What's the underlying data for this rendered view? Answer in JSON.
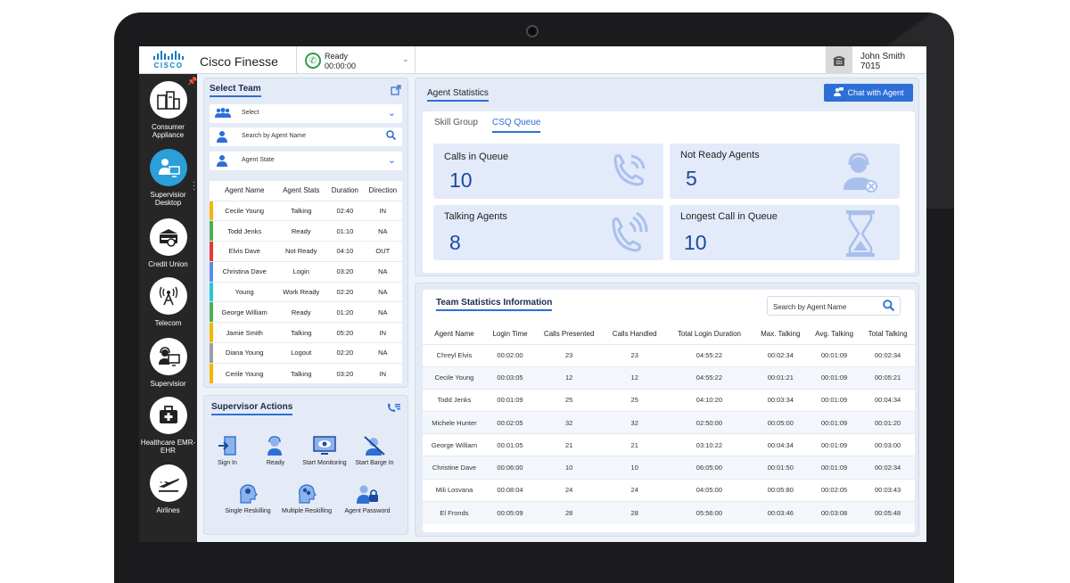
{
  "header": {
    "app_title": "Cisco Finesse",
    "logo_text": "CISCO",
    "agent_state": {
      "label": "Ready",
      "timer": "00:00:00"
    },
    "user": {
      "name": "John Smith",
      "extension": "7015"
    }
  },
  "sidebar": {
    "items": [
      {
        "label": "Consumer Appliance",
        "icon": "appliance-icon",
        "active": false
      },
      {
        "label": "Supervisior Desktop",
        "icon": "supervisor-desktop-icon",
        "active": true
      },
      {
        "label": "Credit Union",
        "icon": "credit-union-icon",
        "active": false
      },
      {
        "label": "Telecom",
        "icon": "telecom-tower-icon",
        "active": false
      },
      {
        "label": "Supervisior",
        "icon": "headset-monitor-icon",
        "active": false
      },
      {
        "label": "Healthcare EMR-EHR",
        "icon": "medical-kit-icon",
        "active": false
      },
      {
        "label": "Airlines",
        "icon": "airplane-icon",
        "active": false
      }
    ]
  },
  "select_team": {
    "title": "Select Team",
    "team_select": "Select",
    "agent_search_placeholder": "Search by Agent Name",
    "agent_state_select": "Agent State",
    "columns": [
      "Agent Name",
      "Agent Stats",
      "Duration",
      "Direction"
    ],
    "rows": [
      {
        "name": "Cecile Young",
        "state": "Talking",
        "duration": "02:40",
        "direction": "IN",
        "color": "#f2b705"
      },
      {
        "name": "Todd Jenks",
        "state": "Ready",
        "duration": "01:10",
        "direction": "NA",
        "color": "#4caf50"
      },
      {
        "name": "Elvis Dave",
        "state": "Not Ready",
        "duration": "04:10",
        "direction": "OUT",
        "color": "#e53935"
      },
      {
        "name": "Christina Dave",
        "state": "Login",
        "duration": "03:20",
        "direction": "NA",
        "color": "#5c8de0"
      },
      {
        "name": "Young",
        "state": "Work Ready",
        "duration": "02:20",
        "direction": "NA",
        "color": "#26c6da"
      },
      {
        "name": "George William",
        "state": "Ready",
        "duration": "01:20",
        "direction": "NA",
        "color": "#4caf50"
      },
      {
        "name": "Jamie Smith",
        "state": "Talking",
        "duration": "05:20",
        "direction": "IN",
        "color": "#f2b705"
      },
      {
        "name": "Diana Young",
        "state": "Logout",
        "duration": "02:20",
        "direction": "NA",
        "color": "#9e9e9e"
      },
      {
        "name": "Cerile Young",
        "state": "Talking",
        "duration": "03:20",
        "direction": "IN",
        "color": "#f2b705"
      }
    ]
  },
  "supervisor_actions": {
    "title": "Supervisor Actions",
    "actions": [
      {
        "label": "Sign In",
        "icon": "sign-in-icon"
      },
      {
        "label": "Ready",
        "icon": "ready-agent-icon"
      },
      {
        "label": "Start Monitoring",
        "icon": "monitor-eye-icon"
      },
      {
        "label": "Start Barge In",
        "icon": "barge-in-icon"
      },
      {
        "label": "Single Reskilling",
        "icon": "single-reskill-icon"
      },
      {
        "label": "Multiple Reskilling",
        "icon": "multiple-reskill-icon"
      },
      {
        "label": "Agent Password",
        "icon": "agent-password-icon"
      }
    ]
  },
  "agent_statistics": {
    "title": "Agent Statistics",
    "chat_button": "Chat with Agent",
    "tabs": [
      "Skill Group",
      "CSQ Queue"
    ],
    "active_tab": "CSQ Queue",
    "cards": [
      {
        "label": "Calls in Queue",
        "value": "10",
        "icon": "phone-call-icon"
      },
      {
        "label": "Not Ready Agents",
        "value": "5",
        "icon": "agent-unavailable-icon"
      },
      {
        "label": "Talking Agents",
        "value": "8",
        "icon": "phone-ringing-icon"
      },
      {
        "label": "Longest Call in Queue",
        "value": "10",
        "icon": "hourglass-icon"
      }
    ]
  },
  "team_statistics": {
    "title": "Team Statistics Information",
    "search_placeholder": "Search by Agent Name",
    "columns": [
      "Agent Name",
      "Login Time",
      "Calls Presented",
      "Calls Handled",
      "Total Login Duration",
      "Max. Talking",
      "Avg. Talking",
      "Total Talking"
    ],
    "rows": [
      [
        "Chreyl Elvis",
        "00:02:00",
        "23",
        "23",
        "04:55:22",
        "00:02:34",
        "00:01:09",
        "00:02:34"
      ],
      [
        "Cecile Young",
        "00:03:05",
        "12",
        "12",
        "04:55:22",
        "00:01:21",
        "00:01:09",
        "00:05:21"
      ],
      [
        "Todd Jenks",
        "00:01:09",
        "25",
        "25",
        "04:10:20",
        "00:03:34",
        "00:01:09",
        "00:04:34"
      ],
      [
        "Michele Hunter",
        "00:02:05",
        "32",
        "32",
        "02:50:00",
        "00:05:00",
        "00:01:09",
        "00:01:20"
      ],
      [
        "George William",
        "00:01:05",
        "21",
        "21",
        "03:10:22",
        "00:04:34",
        "00:01:09",
        "00:03:00"
      ],
      [
        "Christine Dave",
        "00:06:00",
        "10",
        "10",
        "06:05:00",
        "00:01:50",
        "00:01:09",
        "00:02:34"
      ],
      [
        "Mili Losvana",
        "00:08:04",
        "24",
        "24",
        "04:05:00",
        "00:05:80",
        "00:02:05",
        "00:03:43"
      ],
      [
        "El Fronds",
        "00:05:09",
        "28",
        "28",
        "05:56:00",
        "00:03:46",
        "00:03:08",
        "00:05:48"
      ]
    ]
  },
  "colors": {
    "accent": "#2d6fd6",
    "sidebar_bg": "#262626",
    "active_nav": "#2a9fd8",
    "ready_green": "#2e9d45"
  }
}
